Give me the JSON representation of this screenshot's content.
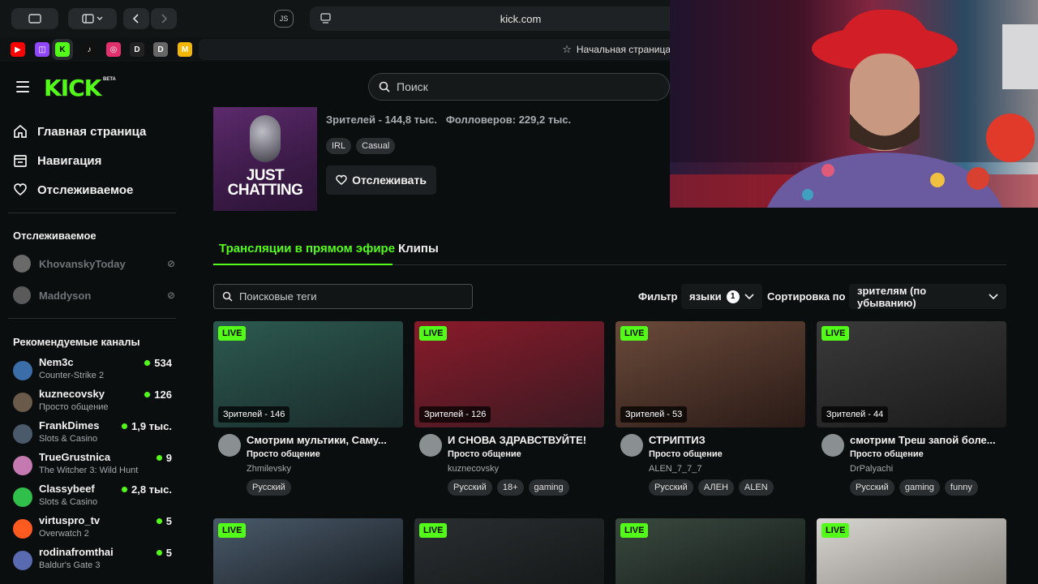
{
  "browser": {
    "url": "kick.com",
    "js_label": "JS",
    "home_tab": "Начальная страница",
    "favicons": [
      {
        "name": "youtube",
        "color": "#ff0000",
        "glyph": "▶"
      },
      {
        "name": "twitch",
        "color": "#9146ff",
        "glyph": "◫"
      },
      {
        "name": "kick",
        "color": "#53fc18",
        "glyph": "K"
      },
      {
        "name": "tiktok",
        "color": "#111111",
        "glyph": "♪"
      },
      {
        "name": "instagram",
        "color": "#e1306c",
        "glyph": "◎"
      },
      {
        "name": "dl",
        "color": "#222222",
        "glyph": "D"
      },
      {
        "name": "d",
        "color": "#666666",
        "glyph": "D"
      },
      {
        "name": "m",
        "color": "#f2b705",
        "glyph": "M"
      }
    ]
  },
  "header": {
    "logo": "KICK",
    "logo_badge": "BETA",
    "search_placeholder": "Поиск"
  },
  "sidebar": {
    "nav": [
      {
        "label": "Главная страница",
        "icon": "home-icon"
      },
      {
        "label": "Навигация",
        "icon": "browse-icon"
      },
      {
        "label": "Отслеживаемое",
        "icon": "heart-icon"
      }
    ],
    "following_heading": "Отслеживаемое",
    "following": [
      {
        "name": "KhovanskyToday"
      },
      {
        "name": "Maddyson"
      }
    ],
    "recommended_heading": "Рекомендуемые каналы",
    "recommended": [
      {
        "name": "Nem3c",
        "category": "Counter-Strike 2",
        "viewers": "534",
        "color": "#3b6ea8"
      },
      {
        "name": "kuznecovsky",
        "category": "Просто общение",
        "viewers": "126",
        "color": "#6a5a4a"
      },
      {
        "name": "FrankDimes",
        "category": "Slots & Casino",
        "viewers": "1,9 тыс.",
        "color": "#4a5a6a"
      },
      {
        "name": "TrueGrustnica",
        "category": "The Witcher 3: Wild Hunt",
        "viewers": "9",
        "color": "#c47ab0"
      },
      {
        "name": "Classybeef",
        "category": "Slots & Casino",
        "viewers": "2,8 тыс.",
        "color": "#2fbf4a"
      },
      {
        "name": "virtuspro_tv",
        "category": "Overwatch 2",
        "viewers": "5",
        "color": "#ff5a1f"
      },
      {
        "name": "rodinafromthai",
        "category": "Baldur's Gate 3",
        "viewers": "5",
        "color": "#5a6ab0"
      }
    ]
  },
  "category": {
    "image_text_1": "JUST",
    "image_text_2": "CHATTING",
    "stats": "Зрителей - 144,8 тыс.   Фолловеров: 229,2 тыс.",
    "tags": [
      "IRL",
      "Casual"
    ],
    "follow_label": "Отслеживать"
  },
  "tabs": {
    "live": "Трансляции в прямом эфире",
    "clips": "Клипы"
  },
  "filters": {
    "tag_search_placeholder": "Поисковые теги",
    "filter_label": "Фильтр",
    "languages_label": "языки",
    "languages_count": "1",
    "sort_label": "Сортировка по",
    "sort_value": "зрителям (по убыванию)"
  },
  "live_badge": "LIVE",
  "streams": [
    {
      "viewers": "Зрителей - 146",
      "title": "Смотрим мультики, Саму...",
      "category": "Просто общение",
      "channel": "Zhmilevsky",
      "tags": [
        "Русский"
      ],
      "colors": [
        "#2c5a50",
        "#1a2a2a"
      ]
    },
    {
      "viewers": "Зрителей - 126",
      "title": "И СНОВА ЗДРАВСТВУЙТЕ!",
      "category": "Просто общение",
      "channel": "kuznecovsky",
      "tags": [
        "Русский",
        "18+",
        "gaming"
      ],
      "colors": [
        "#8a1a2a",
        "#3a1a22"
      ]
    },
    {
      "viewers": "Зрителей - 53",
      "title": "СТРИПТИЗ",
      "category": "Просто общение",
      "channel": "ALEN_7_7_7",
      "tags": [
        "Русский",
        "АЛЕН",
        "ALEN"
      ],
      "colors": [
        "#6a4a3a",
        "#2a1a16"
      ]
    },
    {
      "viewers": "Зрителей - 44",
      "title": "смотрим Треш запой боле...",
      "category": "Просто общение",
      "channel": "DrPalyachi",
      "tags": [
        "Русский",
        "gaming",
        "funny"
      ],
      "colors": [
        "#3a3a3a",
        "#1a1a1a"
      ]
    }
  ],
  "streams_row2": [
    {
      "colors": [
        "#4a5a6a",
        "#1a2026"
      ]
    },
    {
      "colors": [
        "#2a2e30",
        "#16191a"
      ]
    },
    {
      "colors": [
        "#3a4a40",
        "#161c1a"
      ]
    },
    {
      "colors": [
        "#d8d6d2",
        "#8a8680"
      ]
    }
  ]
}
